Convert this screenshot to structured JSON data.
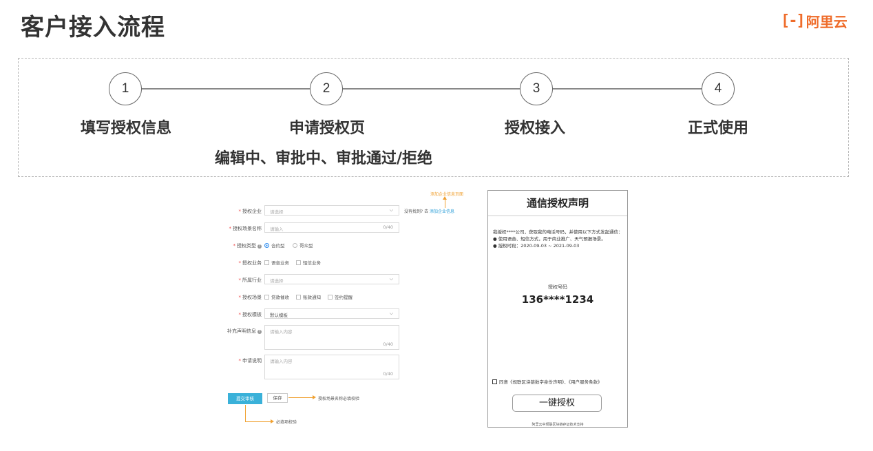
{
  "title": "客户接入流程",
  "logo": {
    "mark": "[-]",
    "text": "阿里云",
    "color": "#ef6c2a"
  },
  "steps": [
    {
      "number": "1",
      "label": "填写授权信息"
    },
    {
      "number": "2",
      "label": "申请授权页",
      "sublabel": "编辑中、审批中、审批通过/拒绝"
    },
    {
      "number": "3",
      "label": "授权接入"
    },
    {
      "number": "4",
      "label": "正式使用"
    }
  ],
  "form": {
    "fields": {
      "enterprise": {
        "label": "授权企业",
        "placeholder": "请选择"
      },
      "scene_name": {
        "label": "授权场景名称",
        "placeholder": "请输入",
        "counter": "0/40"
      },
      "auth_type": {
        "label": "授权类型",
        "options": [
          "合约型",
          "哥众型"
        ],
        "selected": "合约型"
      },
      "auth_business": {
        "label": "授权业务",
        "options": [
          "语音业务",
          "短信业务"
        ]
      },
      "industry": {
        "label": "所属行业",
        "placeholder": "请选择"
      },
      "auth_scene": {
        "label": "授权场景",
        "options": [
          "贷款催收",
          "账款通知",
          "签约提醒"
        ]
      },
      "template": {
        "label": "授权模板",
        "value": "默认模板"
      },
      "supplement": {
        "label": "补充声明信息",
        "placeholder": "请输入内容",
        "counter": "0/40"
      },
      "description": {
        "label": "申请说明",
        "placeholder": "请输入内容",
        "counter": "0/40"
      }
    },
    "enterprise_hint": "没有找到? 去",
    "enterprise_link": "添加企业信息",
    "add_enterprise_note": "添加企业信息页面",
    "submit_label": "提交审核",
    "save_label": "保存",
    "save_note": "授权场景名称必填校验",
    "submit_note": "必填项校验",
    "accent_color": "#3ab1d9",
    "annotation_color": "#f0a030"
  },
  "phone": {
    "title": "通信授权声明",
    "body": "我授权****公司，获取我的电话号码，并使用以下方式发起通信：",
    "bullets": [
      "使用语音、短信方式，用于商业推广、天气预报场景。",
      "授权时段：2020-09-03 ~ 2021-09-03"
    ],
    "number_label": "授权号码",
    "number": "136****1234",
    "agree_text": "同意《规联区块链数字身份声明》、《用户服务条款》",
    "button_label": "一键授权",
    "footer": "阿里云中规联区块链存证技术支持"
  }
}
